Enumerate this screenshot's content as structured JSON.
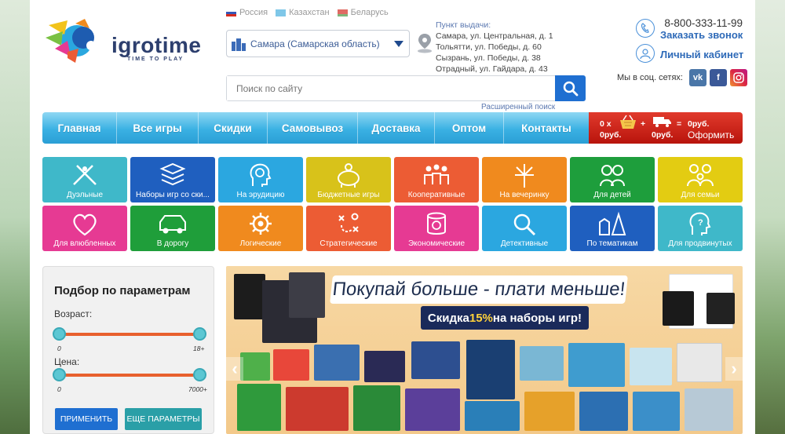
{
  "header": {
    "logo_text": "igrotime",
    "logo_sub": "TIME TO PLAY",
    "countries": [
      {
        "label": "Россия",
        "flag": "ru"
      },
      {
        "label": "Казахстан",
        "flag": "kz"
      },
      {
        "label": "Беларусь",
        "flag": "by"
      }
    ],
    "city": "Самара (Самарская область)",
    "pickup": {
      "title": "Пункт выдачи:",
      "lines": [
        "Самара, ул. Центральная, д. 1",
        "Тольятти, ул. Победы, д. 60",
        "Сызрань, ул. Победы, д. 38",
        "Отрадный, ул. Гайдара, д. 43"
      ]
    },
    "search_placeholder": "Поиск по сайту",
    "advanced_search": "Расширенный поиск",
    "phone": "8-800-333-11-99",
    "callback": "Заказать звонок",
    "cabinet": "Личный кабинет",
    "social_label": "Мы в соц. сетях:",
    "social": {
      "vk": "vk",
      "fb": "f",
      "ig": ""
    }
  },
  "nav": {
    "items": [
      "Главная",
      "Все игры",
      "Скидки",
      "Самовывоз",
      "Доставка",
      "Оптом",
      "Контакты"
    ]
  },
  "cart": {
    "count": "0 х",
    "sum": "0руб.",
    "plus": "+",
    "delivery": "0руб.",
    "eq": "=",
    "total": "0руб.",
    "checkout": "Оформить"
  },
  "categories": [
    {
      "label": "Дуэльные",
      "color": "#3fb8c9",
      "icon": "fencing-icon"
    },
    {
      "label": "Наборы игр со ски...",
      "color": "#1f5fbf",
      "icon": "stack-icon"
    },
    {
      "label": "На эрудицию",
      "color": "#2ba7e0",
      "icon": "head-bulb-icon"
    },
    {
      "label": "Бюджетные игры",
      "color": "#d8c21a",
      "icon": "piggy-bank-icon"
    },
    {
      "label": "Кооперативные",
      "color": "#ec5c34",
      "icon": "team-icon"
    },
    {
      "label": "На вечеринку",
      "color": "#f08a1e",
      "icon": "fireworks-icon"
    },
    {
      "label": "Для детей",
      "color": "#1e9e3c",
      "icon": "kids-icon"
    },
    {
      "label": "Для семьи",
      "color": "#e3cc12",
      "icon": "family-icon"
    },
    {
      "label": "Для влюбленных",
      "color": "#e63a93",
      "icon": "hearts-icon"
    },
    {
      "label": "В дорогу",
      "color": "#1f9e3a",
      "icon": "car-icon"
    },
    {
      "label": "Логические",
      "color": "#f08a1e",
      "icon": "gear-icon"
    },
    {
      "label": "Стратегические",
      "color": "#ec5c34",
      "icon": "strategy-icon"
    },
    {
      "label": "Экономические",
      "color": "#e63a93",
      "icon": "coins-icon"
    },
    {
      "label": "Детективные",
      "color": "#2ba7e0",
      "icon": "magnifier-icon"
    },
    {
      "label": "По тематикам",
      "color": "#1f5fbf",
      "icon": "themes-icon"
    },
    {
      "label": "Для продвинутых",
      "color": "#3fb8c9",
      "icon": "brain-icon"
    }
  ],
  "filter": {
    "title": "Подбор по параметрам",
    "age_label": "Возраст:",
    "age_min": "0",
    "age_max": "18+",
    "price_label": "Цена:",
    "price_min": "0",
    "price_max": "7000+",
    "apply": "ПРИМЕНИТЬ",
    "more": "ЕЩЕ ПАРАМЕТРЫ"
  },
  "banner": {
    "headline": "Покупай больше - плати меньше!",
    "sub_prefix": "Скидка ",
    "sub_percent": "15%",
    "sub_suffix": " на наборы игр!",
    "prev": "‹",
    "next": "›"
  }
}
